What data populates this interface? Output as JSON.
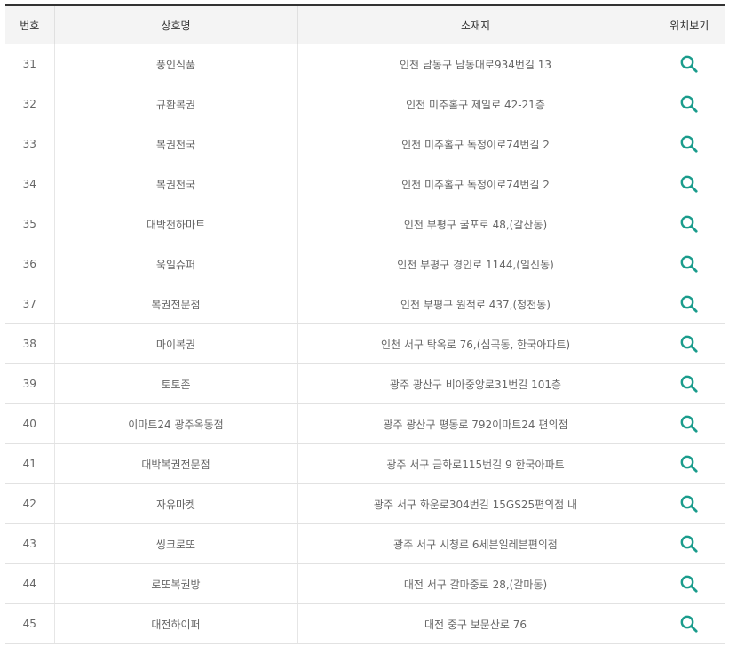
{
  "columns": {
    "number": "번호",
    "name": "상호명",
    "address": "소재지",
    "view": "위치보기"
  },
  "accent_color": "#1a9c8c",
  "view_icon": "search-icon",
  "rows": [
    {
      "no": "31",
      "name": "풍인식품",
      "address": "인천 남동구 남동대로934번길 13"
    },
    {
      "no": "32",
      "name": "규환복권",
      "address": "인천 미추홀구 제일로 42-21층"
    },
    {
      "no": "33",
      "name": "복권천국",
      "address": "인천 미추홀구 독정이로74번길 2"
    },
    {
      "no": "34",
      "name": "복권천국",
      "address": "인천 미추홀구 독정이로74번길 2"
    },
    {
      "no": "35",
      "name": "대박천하마트",
      "address": "인천 부평구 굴포로 48,(갈산동)"
    },
    {
      "no": "36",
      "name": "욱일슈퍼",
      "address": "인천 부평구 경인로 1144,(일신동)"
    },
    {
      "no": "37",
      "name": "복권전문점",
      "address": "인천 부평구 원적로 437,(청천동)"
    },
    {
      "no": "38",
      "name": "마이복권",
      "address": "인천 서구 탁옥로 76,(심곡동, 한국아파트)"
    },
    {
      "no": "39",
      "name": "토토존",
      "address": "광주 광산구 비아중앙로31번길 101층"
    },
    {
      "no": "40",
      "name": "이마트24 광주옥동점",
      "address": "광주 광산구 평동로 792이마트24 편의점"
    },
    {
      "no": "41",
      "name": "대박복권전문점",
      "address": "광주 서구 금화로115번길 9 한국아파트"
    },
    {
      "no": "42",
      "name": "자유마켓",
      "address": "광주 서구 화운로304번길 15GS25편의점 내"
    },
    {
      "no": "43",
      "name": "씽크로또",
      "address": "광주 서구 시청로 6세븐일레븐편의점"
    },
    {
      "no": "44",
      "name": "로또복권방",
      "address": "대전 서구 갈마중로 28,(갈마동)"
    },
    {
      "no": "45",
      "name": "대전하이퍼",
      "address": "대전 중구 보문산로 76"
    }
  ]
}
